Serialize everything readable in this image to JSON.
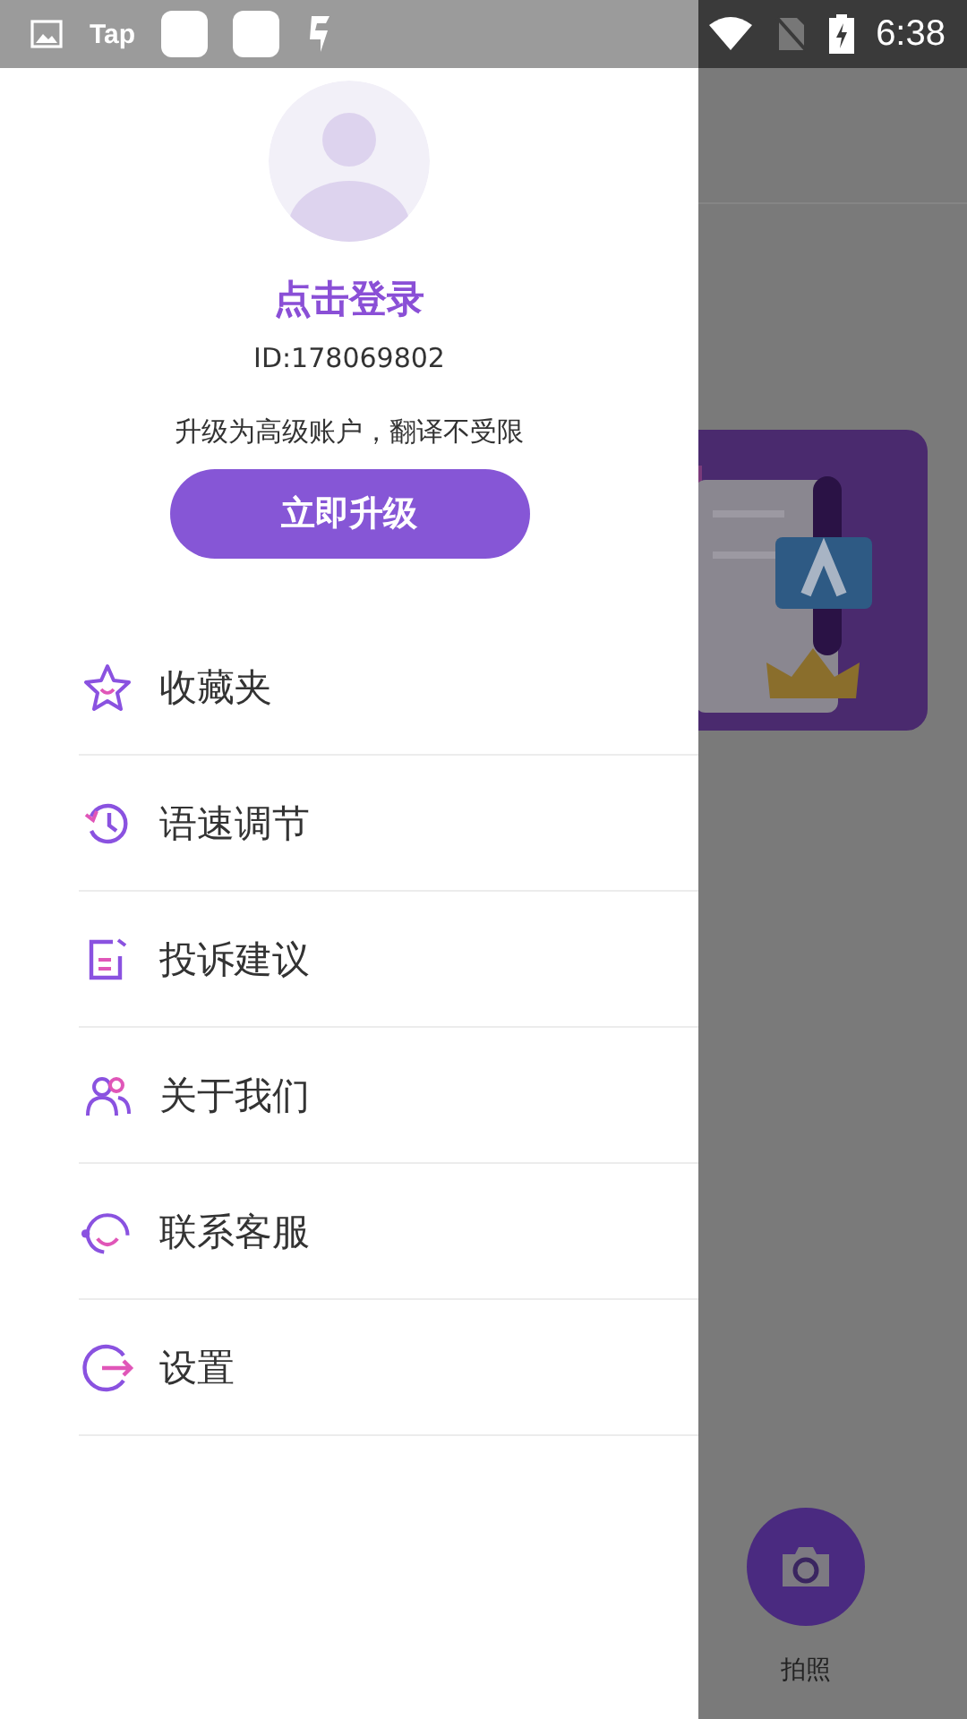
{
  "status_bar": {
    "app_label": "Tap",
    "time": "6:38"
  },
  "drawer": {
    "login_title": "点击登录",
    "user_id": "ID:178069802",
    "upgrade_hint": "升级为高级账户，翻译不受限",
    "upgrade_button": "立即升级",
    "menu": [
      {
        "label": "收藏夹",
        "kind": "star"
      },
      {
        "label": "语速调节",
        "kind": "history"
      },
      {
        "label": "投诉建议",
        "kind": "edit"
      },
      {
        "label": "关于我们",
        "kind": "people"
      },
      {
        "label": "联系客服",
        "kind": "headset"
      },
      {
        "label": "设置",
        "kind": "exit"
      }
    ]
  },
  "background": {
    "camera_label": "拍照"
  }
}
